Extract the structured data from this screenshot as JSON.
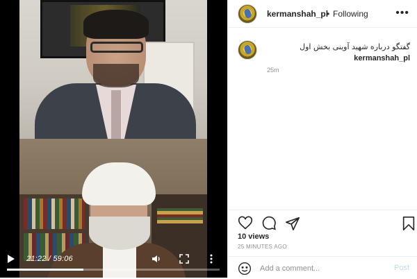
{
  "video": {
    "current_time": "21:22",
    "separator": " / ",
    "duration": "59:06",
    "progress": 0.36,
    "icons": {
      "play": "play-icon",
      "volume": "volume-icon",
      "fullscreen": "fullscreen-icon",
      "more": "more-vertical-icon"
    }
  },
  "post": {
    "username": "kermanshah_pl",
    "dot": "•",
    "follow_status": "Following",
    "more_label": "•••",
    "caption": {
      "username": "kermanshah_pl",
      "text": "گفتگو درباره شهید آوینی بخش اول",
      "time": "25m"
    },
    "views": "10 views",
    "posted_ago": "25 MINUTES AGO",
    "icons": {
      "like": "heart-icon",
      "comment": "comment-icon",
      "share": "share-icon",
      "save": "bookmark-icon",
      "emoji": "emoji-icon"
    }
  },
  "comment_box": {
    "placeholder": "Add a comment...",
    "post_label": "Post"
  },
  "colors": {
    "accent": "#0095f6",
    "post_disabled": "#b2dffc",
    "text": "#262626",
    "muted": "#8e8e8e"
  }
}
